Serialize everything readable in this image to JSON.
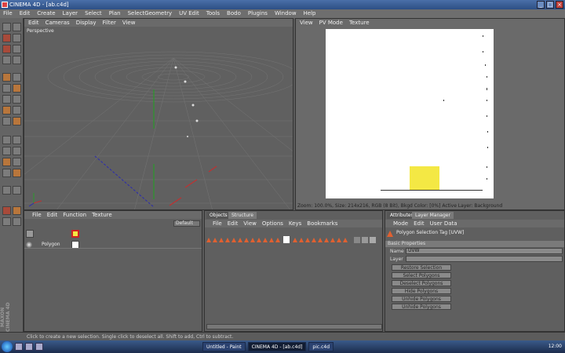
{
  "window": {
    "title": "CINEMA 4D - [ab.c4d]",
    "controls": [
      "_",
      "□",
      "×"
    ]
  },
  "menubar": [
    "File",
    "Edit",
    "Create",
    "Layer",
    "Select",
    "Plan",
    "SelectGeometry",
    "UV Edit",
    "Tools",
    "Bodo",
    "Plugins",
    "Window",
    "Help"
  ],
  "viewport": {
    "menu": [
      "Edit",
      "Cameras",
      "Display",
      "Filter",
      "View"
    ],
    "label": "Perspective"
  },
  "picture_viewer": {
    "menu": [
      "View",
      "PV Mode",
      "Texture"
    ],
    "status": "Zoom: 100.0%, Size: 214x216, RGB (8 Bit), Bkgd Color: [0%] Active Layer: Background"
  },
  "object_manager": {
    "menu": [
      "File",
      "Edit",
      "Function",
      "Texture"
    ],
    "mode": "Default",
    "object_name": "Polygon"
  },
  "timeline": {
    "tabs": [
      "Objects",
      "Structure"
    ],
    "menu": [
      "File",
      "Edit",
      "View",
      "Options",
      "Keys",
      "Bookmarks"
    ]
  },
  "attributes": {
    "tabs": [
      "Attributes",
      "Layer Manager"
    ],
    "menu": [
      "Mode",
      "Edit",
      "User Data"
    ],
    "title": "Polygon Selection Tag [UVW]",
    "section": "Basic Properties",
    "fields": [
      {
        "label": "Name",
        "value": "UVW"
      },
      {
        "label": "Layer",
        "value": ""
      }
    ],
    "buttons": [
      "Restore Selection",
      "Select Polygons",
      "Deselect Polygons",
      "Hide Polygons",
      "Unhide Polygons",
      "Unhide Polygons"
    ]
  },
  "status": "Click to create a new selection. Single click to deselect all. Shift to add, Ctrl to subtract.",
  "taskbar": {
    "items": [
      "Untitled - Paint",
      "CINEMA 4D - [ab.c4d]",
      "pic.c4d"
    ],
    "clock": "12:00"
  },
  "brand": "MAXON CINEMA 4D"
}
